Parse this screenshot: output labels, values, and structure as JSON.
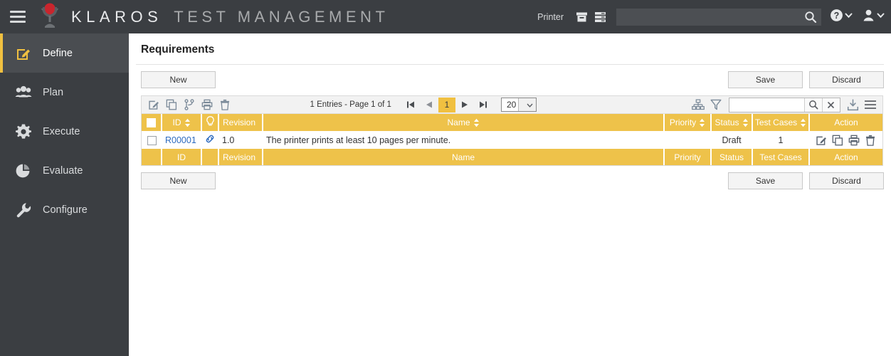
{
  "header": {
    "brand_main": "KLAROS",
    "brand_sub": "TEST MANAGEMENT",
    "printer_label": "Printer",
    "search_placeholder": "",
    "search_value": "",
    "menu_icon": "hamburger-icon",
    "logo_icon": "klaros-logo-icon",
    "archive_icon": "archive-box-icon",
    "database_icon": "server-stack-icon",
    "search_icon": "search-icon",
    "help_icon": "help-circle-icon",
    "user_icon": "user-icon",
    "chevron_icon": "chevron-down-icon"
  },
  "sidebar": {
    "items": [
      {
        "label": "Define",
        "icon": "edit-pencil-icon",
        "active": true
      },
      {
        "label": "Plan",
        "icon": "people-group-icon",
        "active": false
      },
      {
        "label": "Execute",
        "icon": "gear-icon",
        "active": false
      },
      {
        "label": "Evaluate",
        "icon": "pie-chart-icon",
        "active": false
      },
      {
        "label": "Configure",
        "icon": "wrench-icon",
        "active": false
      }
    ]
  },
  "main": {
    "page_title": "Requirements",
    "buttons": {
      "new": "New",
      "save": "Save",
      "discard": "Discard"
    },
    "toolbar": {
      "icons": [
        "edit-icon",
        "copy-icon",
        "branch-icon",
        "print-icon",
        "delete-icon"
      ],
      "right_icons": [
        "hierarchy-icon",
        "filter-funnel-icon",
        "export-download-icon",
        "menu-list-icon"
      ],
      "filter_value": "",
      "filter_placeholder": "",
      "filter_search_icon": "search-icon",
      "filter_clear_icon": "close-x-icon"
    },
    "pagination": {
      "entries_text": "1 Entries - Page 1 of 1",
      "first_icon": "first-page-icon",
      "prev_icon": "previous-page-icon",
      "current_page": "1",
      "next_icon": "next-page-icon",
      "last_icon": "last-page-icon",
      "page_size": "20"
    },
    "table": {
      "columns": [
        {
          "key": "check",
          "label": "",
          "sortable": false
        },
        {
          "key": "id",
          "label": "ID",
          "sortable": true
        },
        {
          "key": "bulb",
          "label": "",
          "sortable": false,
          "icon": "lightbulb-icon"
        },
        {
          "key": "rev",
          "label": "Revision",
          "sortable": false
        },
        {
          "key": "name",
          "label": "Name",
          "sortable": true
        },
        {
          "key": "pri",
          "label": "Priority",
          "sortable": true
        },
        {
          "key": "status",
          "label": "Status",
          "sortable": true
        },
        {
          "key": "tc",
          "label": "Test Cases",
          "sortable": true
        },
        {
          "key": "action",
          "label": "Action",
          "sortable": false
        }
      ],
      "rows": [
        {
          "id": "R00001",
          "link_icon": "link-chain-icon",
          "revision": "1.0",
          "name": "The printer prints at least 10 pages per minute.",
          "priority": "",
          "status": "Draft",
          "test_cases": "1",
          "actions": [
            "edit-icon",
            "copy-icon",
            "print-icon",
            "delete-icon"
          ]
        }
      ]
    }
  },
  "colors": {
    "accent_gold": "#eec24a",
    "header_dark": "#3b3e42",
    "sidebar_active": "#4a4d51",
    "link_blue": "#2e6bbf",
    "logo_red": "#c9252d"
  }
}
